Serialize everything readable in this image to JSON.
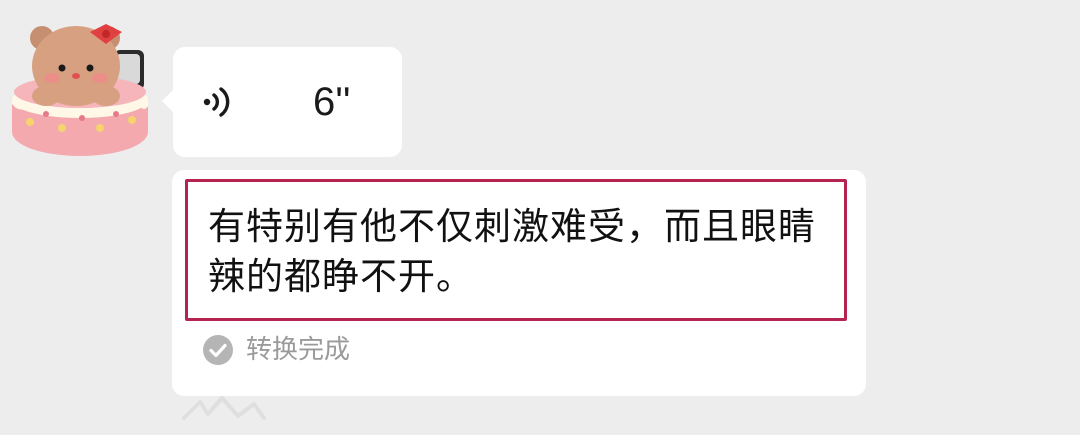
{
  "avatar": {
    "icon": "bear-cake-avatar-icon"
  },
  "voice_message": {
    "icon": "voice-wave-icon",
    "duration": "6''"
  },
  "transcript": {
    "text": "有特别有他不仅刺激难受，而且眼睛辣的都睁不开。",
    "highlight_color": "#b52450",
    "status_icon": "check-circle-icon",
    "status_label": "转换完成"
  },
  "colors": {
    "background": "#ededed",
    "bubble": "#ffffff",
    "status_text": "#9a9a9a",
    "status_icon": "#b5b5b5"
  }
}
